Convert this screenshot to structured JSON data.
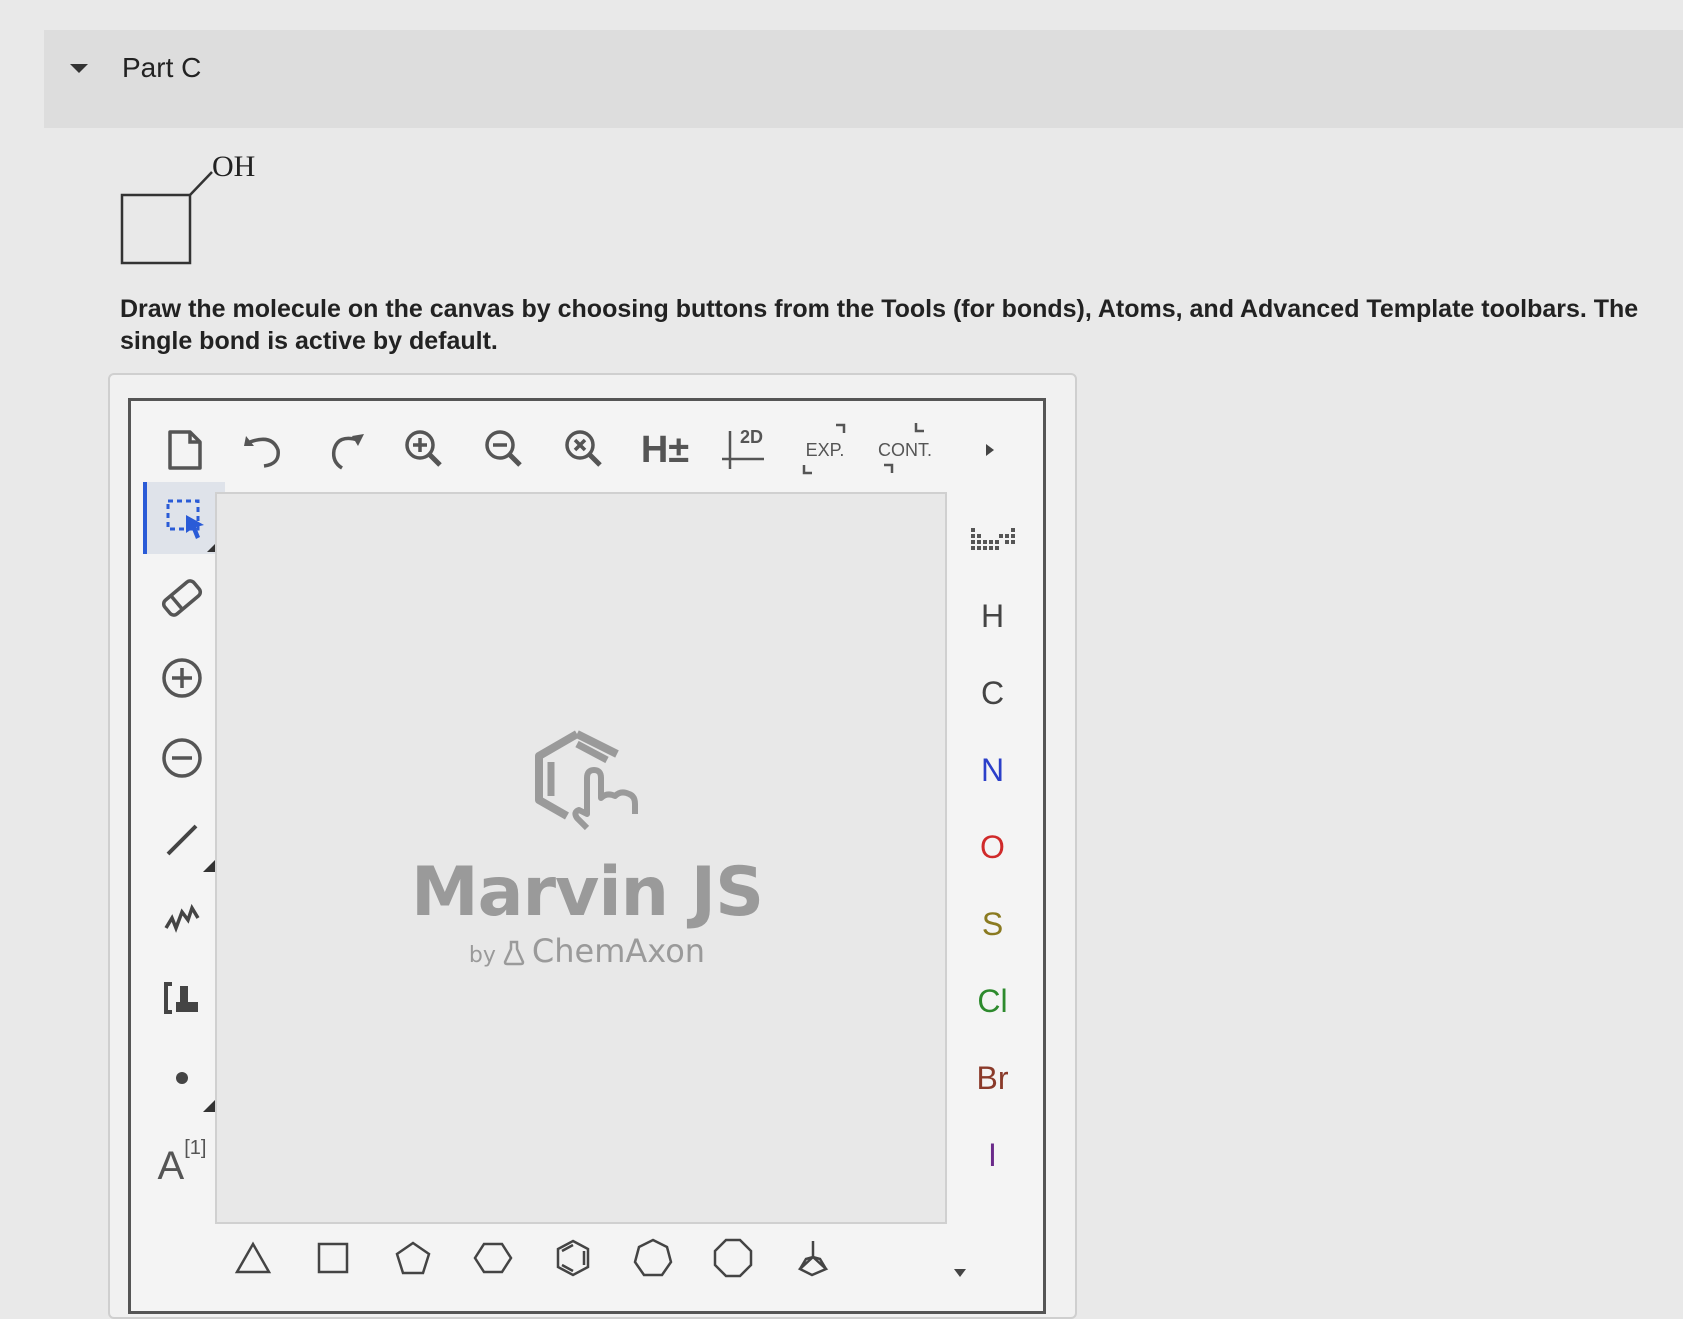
{
  "part": {
    "title": "Part C"
  },
  "molecule": {
    "label": "OH"
  },
  "instructions": "Draw the molecule on the canvas by choosing buttons from the Tools (for bonds), Atoms, and Advanced Template toolbars. The single bond is active by default.",
  "top_toolbar": {
    "h_label": "H±",
    "clean_label": "2D",
    "expand_label": "EXP.",
    "contract_label": "CONT."
  },
  "left_toolbar": {
    "rgroup_label": "A",
    "rgroup_index": "[1]"
  },
  "canvas_logo": {
    "title": "Marvin JS",
    "by": "by",
    "company": "ChemAxon"
  },
  "atoms": [
    {
      "symbol": "H",
      "color": "#444444"
    },
    {
      "symbol": "C",
      "color": "#444444"
    },
    {
      "symbol": "N",
      "color": "#2b3fc9"
    },
    {
      "symbol": "O",
      "color": "#d02a2a"
    },
    {
      "symbol": "S",
      "color": "#8a7a20"
    },
    {
      "symbol": "Cl",
      "color": "#2d8a2d"
    },
    {
      "symbol": "Br",
      "color": "#8a3a2a"
    },
    {
      "symbol": "I",
      "color": "#6a2a8a"
    }
  ]
}
